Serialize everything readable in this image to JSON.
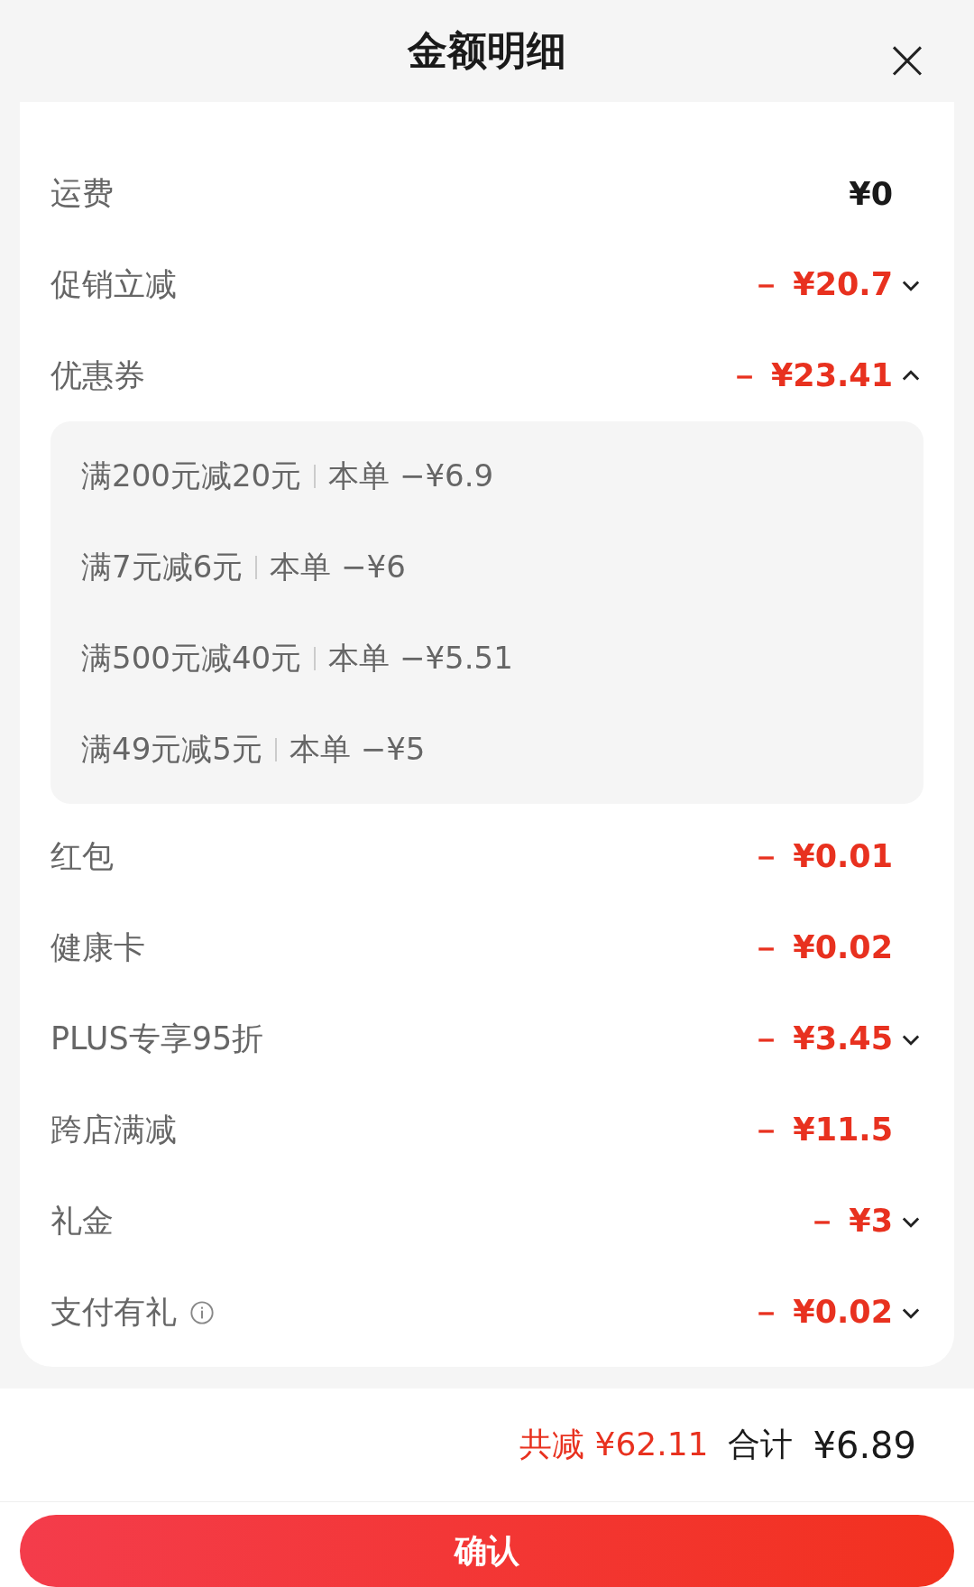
{
  "header": {
    "title": "金额明细",
    "close": "×"
  },
  "rows": [
    {
      "label": "运费",
      "value": "¥0",
      "kind": "charge"
    },
    {
      "label": "促销立减",
      "value": "－ ¥20.7",
      "kind": "discount",
      "expanded": false
    },
    {
      "label": "优惠券",
      "value": "－ ¥23.41",
      "kind": "discount",
      "expanded": true,
      "details": [
        {
          "rule": "满200元减20元",
          "amount": "本单 −¥6.9"
        },
        {
          "rule": "满7元减6元",
          "amount": "本单 −¥6"
        },
        {
          "rule": "满500元减40元",
          "amount": "本单 −¥5.51"
        },
        {
          "rule": "满49元减5元",
          "amount": "本单 −¥5"
        }
      ]
    },
    {
      "label": "红包",
      "value": "－ ¥0.01",
      "kind": "discount"
    },
    {
      "label": "健康卡",
      "value": "－ ¥0.02",
      "kind": "discount"
    },
    {
      "label": "PLUS专享95折",
      "value": "－ ¥3.45",
      "kind": "discount",
      "expanded": false
    },
    {
      "label": "跨店满减",
      "value": "－ ¥11.5",
      "kind": "discount"
    },
    {
      "label": "礼金",
      "value": "－ ¥3",
      "kind": "discount",
      "expanded": false
    },
    {
      "label": "支付有礼",
      "value": "－ ¥0.02",
      "kind": "discount",
      "expanded": false,
      "info": true
    }
  ],
  "footer": {
    "saved": "共减 ¥62.11",
    "total_label": "合计",
    "total": "¥6.89"
  },
  "confirm_button": "确认"
}
